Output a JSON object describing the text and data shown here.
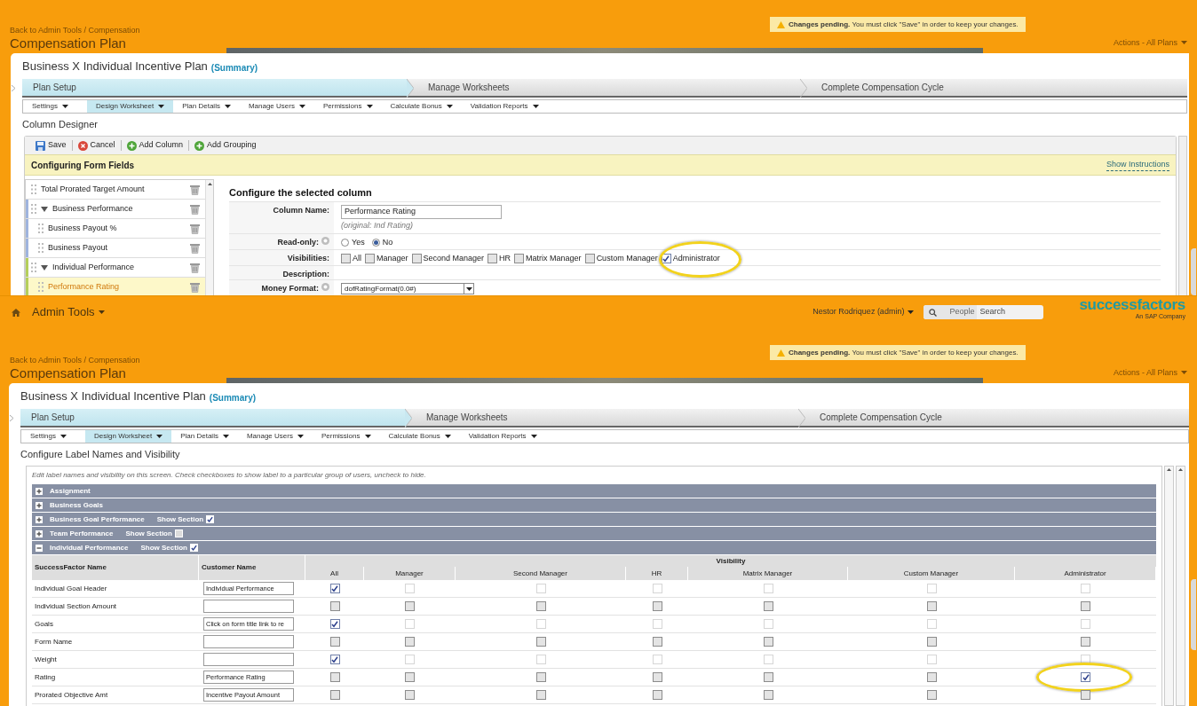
{
  "top": {
    "breadcrumb": "Back to Admin Tools / Compensation",
    "page_title": "Compensation Plan",
    "notice": "**Changes pending.** You must click \"Save\" in order to keep your changes.",
    "actions_menu": "Actions - All Plans",
    "plan_title": "Business X Individual Incentive Plan",
    "summary_link": "(Summary)",
    "steps": [
      {
        "label": "Plan Setup",
        "selected": true
      },
      {
        "label": "Manage Worksheets",
        "selected": false
      },
      {
        "label": "Complete Compensation Cycle",
        "selected": false
      }
    ],
    "subtabs": [
      {
        "label": "Settings",
        "selected": false
      },
      {
        "label": "Design Worksheet",
        "selected": true
      },
      {
        "label": "Plan Details",
        "selected": false
      },
      {
        "label": "Manage Users",
        "selected": false
      },
      {
        "label": "Permissions",
        "selected": false
      },
      {
        "label": "Calculate Bonus",
        "selected": false
      },
      {
        "label": "Validation Reports",
        "selected": false
      }
    ],
    "section_title": "Column Designer",
    "toolbar": [
      {
        "label": "Save",
        "kind": "save"
      },
      {
        "label": "Cancel",
        "kind": "cancel"
      },
      {
        "label": "Add Column",
        "kind": "add"
      },
      {
        "label": "Add Grouping",
        "kind": "add"
      }
    ],
    "band_title": "Configuring Form Fields",
    "instructions_link": "Show Instructions",
    "fields": [
      {
        "label": "Total Prorated Target Amount",
        "selected": false
      },
      {
        "label": "Business Performance",
        "selected": false,
        "expanded": true,
        "color": "#9fb4de",
        "children": [
          {
            "label": "Business Payout %",
            "selected": false
          },
          {
            "label": "Business Payout",
            "selected": false
          }
        ]
      },
      {
        "label": "Individual Performance",
        "selected": false,
        "expanded": true,
        "color": "#b5cf5a",
        "children": [
          {
            "label": "Performance Rating",
            "selected": true
          }
        ]
      }
    ],
    "config": {
      "heading": "Configure the selected column",
      "column_name": {
        "label": "Column Name:",
        "value": "Performance Rating",
        "note": "(original: Ind Rating)"
      },
      "read_only": {
        "label": "Read-only:",
        "options": [
          {
            "label": "Yes",
            "selected": false
          },
          {
            "label": "No",
            "selected": true
          }
        ]
      },
      "visibilities": {
        "label": "Visibilities:",
        "options": [
          {
            "label": "All",
            "checked": false,
            "highlighted": false
          },
          {
            "label": "Manager",
            "checked": false,
            "highlighted": false
          },
          {
            "label": "Second Manager",
            "checked": false,
            "highlighted": false
          },
          {
            "label": "HR",
            "checked": false,
            "highlighted": false
          },
          {
            "label": "Matrix Manager",
            "checked": false,
            "highlighted": false
          },
          {
            "label": "Custom Manager",
            "checked": false,
            "highlighted": false
          },
          {
            "label": "Administrator",
            "checked": true,
            "highlighted": true
          }
        ]
      },
      "description": {
        "label": "Description:"
      },
      "money_format": {
        "label": "Money Format:",
        "value": "dofRatingFormat(0.0#)"
      }
    }
  },
  "bottom": {
    "nav": {
      "menu": "Admin Tools",
      "user": "Nestor Rodriquez (admin)",
      "search_scope": "People",
      "search_placeholder": "Search",
      "logo": "successfactors",
      "logo_tagline": "An SAP Company"
    },
    "breadcrumb": "Back to Admin Tools / Compensation",
    "page_title": "Compensation Plan",
    "notice": "**Changes pending.** You must click \"Save\" in order to keep your changes.",
    "actions_menu": "Actions - All Plans",
    "plan_title": "Business X Individual Incentive Plan",
    "summary_link": "(Summary)",
    "steps": [
      {
        "label": "Plan Setup",
        "selected": true
      },
      {
        "label": "Manage Worksheets",
        "selected": false
      },
      {
        "label": "Complete Compensation Cycle",
        "selected": false
      }
    ],
    "subtabs": [
      {
        "label": "Settings",
        "selected": false
      },
      {
        "label": "Design Worksheet",
        "selected": true
      },
      {
        "label": "Plan Details",
        "selected": false
      },
      {
        "label": "Manage Users",
        "selected": false
      },
      {
        "label": "Permissions",
        "selected": false
      },
      {
        "label": "Calculate Bonus",
        "selected": false
      },
      {
        "label": "Validation Reports",
        "selected": false
      }
    ],
    "section_title": "Configure Label Names and Visibility",
    "hint": "Edit label names and visibility on this screen. Check checkboxes to show label to a particular group of users, uncheck to hide.",
    "sections": [
      {
        "label": "Assignment",
        "expanded": false
      },
      {
        "label": "Business Goals",
        "expanded": false
      },
      {
        "label": "Business Goal Performance",
        "expanded": false,
        "show_section": {
          "label": "Show Section",
          "checked": true
        }
      },
      {
        "label": "Team Performance",
        "expanded": false,
        "show_section": {
          "label": "Show Section",
          "checked": false
        }
      },
      {
        "label": "Individual Performance",
        "expanded": true,
        "show_section": {
          "label": "Show Section",
          "checked": true
        }
      }
    ],
    "table": {
      "columns": [
        "SuccessFactor Name",
        "Customer Name"
      ],
      "group_header": "Visibility",
      "visibility_columns": [
        "All",
        "Manager",
        "Second Manager",
        "HR",
        "Matrix Manager",
        "Custom Manager",
        "Administrator"
      ],
      "rows": [
        {
          "name": "Individual Goal Header",
          "value": "Individual Performance",
          "checks": [
            true,
            false,
            false,
            false,
            false,
            false,
            false
          ],
          "others_disabled": true,
          "highlighted": false
        },
        {
          "name": "Individual Section Amount",
          "checks": [
            false,
            false,
            false,
            false,
            false,
            false,
            false
          ],
          "others_disabled": false,
          "highlighted": false
        },
        {
          "name": "Goals",
          "value": "Click on form title link to re",
          "checks": [
            true,
            false,
            false,
            false,
            false,
            false,
            false
          ],
          "others_disabled": true,
          "highlighted": false
        },
        {
          "name": "Form Name",
          "checks": [
            false,
            false,
            false,
            false,
            false,
            false,
            false
          ],
          "others_disabled": false,
          "highlighted": false
        },
        {
          "name": "Weight",
          "checks": [
            true,
            false,
            false,
            false,
            false,
            false,
            false
          ],
          "others_disabled": true,
          "highlighted": false
        },
        {
          "name": "Rating",
          "value": "Performance Rating",
          "checks": [
            false,
            false,
            false,
            false,
            false,
            false,
            true
          ],
          "others_disabled": false,
          "highlighted": true
        },
        {
          "name": "Prorated Objective Amt",
          "value": "Incentive Payout Amount",
          "checks": [
            false,
            false,
            false,
            false,
            false,
            false,
            false
          ],
          "others_disabled": false,
          "highlighted": false
        }
      ]
    }
  }
}
